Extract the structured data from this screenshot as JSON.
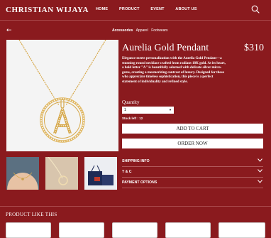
{
  "brand": {
    "name": "CHRISTIAN WIJAYA"
  },
  "nav": {
    "items": [
      "HOME",
      "PRODUCT",
      "EVENT",
      "ABOUT US"
    ]
  },
  "breadcrumb": [
    "Accessories",
    "Apparel",
    "Footwears"
  ],
  "product": {
    "name": "Aurelia Gold Pendant",
    "price": "$310",
    "description": "Elegance meets personalization with the Aurelia Gold Pendant—a stunning round necklace crafted from radiant 18K gold. At its heart, a bold letter \"A\" is beautifully adorned with delicate silver micro-gems, creating a mesmerizing contrast of luxury. Designed for those who appreciate timeless sophistication, this piece is a perfect statement of individuality and refined style.",
    "quantity_label": "Quantity",
    "quantity_value": "1",
    "stock_text": "Stock left : 12",
    "add_to_cart_label": "ADD TO CART",
    "order_now_label": "ORDER NOW"
  },
  "accordion": [
    "SHIPPING INFO",
    "T & C",
    "PAYMENT OPTIONS"
  ],
  "related": {
    "title": "PRODUCT LIKE THIS"
  },
  "colors": {
    "background": "#8a1a1e",
    "gold": "#d6a84a"
  }
}
